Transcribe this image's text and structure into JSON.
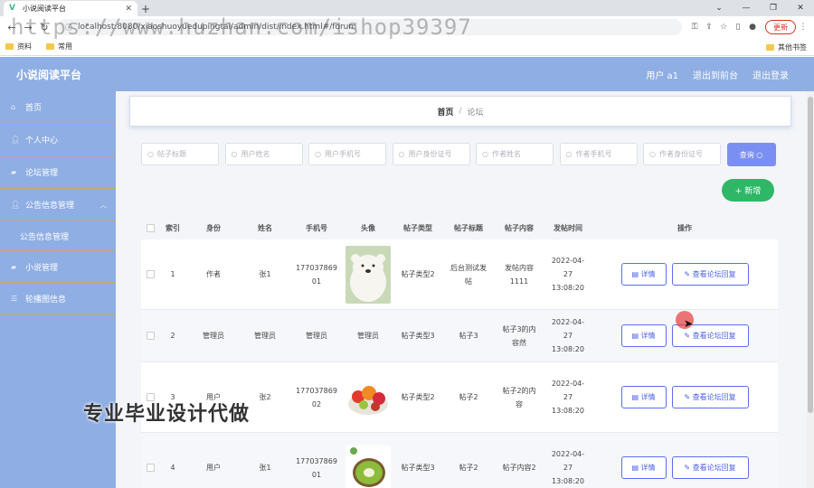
{
  "browser": {
    "tab_title": "小说阅读平台",
    "url": "localhost:8080/xiaoshuoyuedupingtai/admin/dist/index.html#/forum",
    "update_label": "更新",
    "bookmarks": [
      "资料",
      "常用"
    ],
    "bookmarks_right": "其他书签"
  },
  "watermark": "https://www.huzhan.com/ishop39397",
  "header": {
    "title": "小说阅读平台",
    "user": "用户 a1",
    "back_front": "退出到前台",
    "logout": "退出登录"
  },
  "sidebar": {
    "items": [
      {
        "label": "首页",
        "icon": "home-icon"
      },
      {
        "label": "个人中心",
        "icon": "user-icon"
      },
      {
        "label": "论坛管理",
        "icon": "forum-icon"
      },
      {
        "label": "公告信息管理",
        "icon": "notice-icon"
      },
      {
        "label": "公告信息管理",
        "icon": ""
      },
      {
        "label": "小说管理",
        "icon": "book-icon"
      },
      {
        "label": "轮播图信息",
        "icon": "list-icon"
      }
    ]
  },
  "breadcrumb": {
    "home": "首页",
    "separator": "/",
    "current": "论坛"
  },
  "filters": {
    "placeholders": [
      "帖子标题",
      "用户姓名",
      "用户手机号",
      "用户身份证号",
      "作者姓名",
      "作者手机号",
      "作者身份证号"
    ],
    "query_label": "查询"
  },
  "add_label": "+ 新增",
  "table": {
    "headers": [
      "索引",
      "身份",
      "姓名",
      "手机号",
      "头像",
      "帖子类型",
      "帖子标题",
      "帖子内容",
      "发帖时间",
      "操作"
    ],
    "detail_label": "详情",
    "reply_label": "查看论坛回复",
    "rows": [
      {
        "index": "1",
        "role": "作者",
        "name": "张1",
        "phone": "17703786901",
        "avatar": "bear",
        "type": "帖子类型2",
        "title": "后台测试发帖",
        "content": "发帖内容1111",
        "time": "2022-04-27 13:08:20"
      },
      {
        "index": "2",
        "role": "管理员",
        "name": "管理员",
        "phone": "管理员",
        "avatar_text": "管理员",
        "type": "帖子类型3",
        "title": "帖子3",
        "content": "帖子3的内容然",
        "time": "2022-04-27 13:08:20"
      },
      {
        "index": "3",
        "role": "用户",
        "name": "张2",
        "phone": "17703786902",
        "avatar": "food",
        "type": "帖子类型2",
        "title": "帖子2",
        "content": "帖子2的内容",
        "time": "2022-04-27 13:08:20"
      },
      {
        "index": "4",
        "role": "用户",
        "name": "张1",
        "phone": "17703786901",
        "avatar": "kiwi",
        "type": "帖子类型3",
        "title": "帖子2",
        "content": "帖子内容2",
        "time": "2022-04-27 13:08:20"
      }
    ]
  },
  "overlay_text": "专业毕业设计代做",
  "colors": {
    "header": "#8faee3",
    "primary": "#7b8ff2",
    "success": "#2fb767"
  }
}
